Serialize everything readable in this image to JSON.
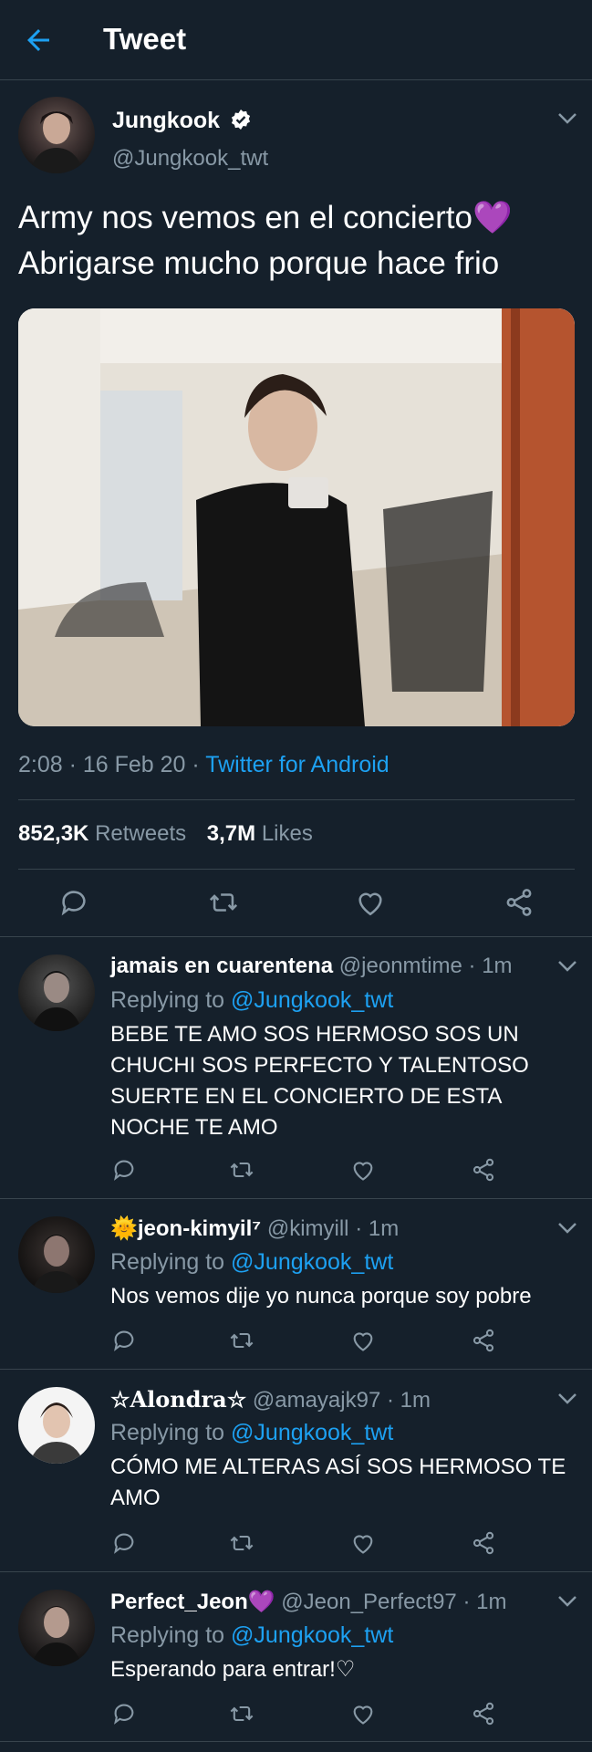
{
  "header": {
    "title": "Tweet"
  },
  "tweet": {
    "author_name": "Jungkook",
    "handle": "@Jungkook_twt",
    "text_line1": "Army nos vemos en el concierto💜",
    "text_line2": "Abrigarse mucho porque hace frio",
    "time_date": "2:08 · 16 Feb 20 · ",
    "source": "Twitter for Android",
    "retweets_count": "852,3K",
    "retweets_label": "Retweets",
    "likes_count": "3,7M",
    "likes_label": "Likes"
  },
  "replies": [
    {
      "name": "jamais en cuarentena",
      "handle": "@jeonmtime",
      "time": "· 1m",
      "replying_prefix": "Replying to ",
      "replying_handle": "@Jungkook_twt",
      "text_lines": [
        "BEBE TE AMO SOS HERMOSO SOS UN",
        "CHUCHI SOS PERFECTO Y TALENTOSO",
        "SUERTE EN EL CONCIERTO DE ESTA",
        "NOCHE TE AMO"
      ]
    },
    {
      "name": "🌞jeon-kimyil⁷",
      "handle": "@kimyill",
      "time": "· 1m",
      "replying_prefix": "Replying to ",
      "replying_handle": "@Jungkook_twt",
      "text_lines": [
        "Nos vemos dije yo nunca porque soy pobre"
      ]
    },
    {
      "name": "☆Alondra☆",
      "handle": "@amayajk97",
      "time": "· 1m",
      "replying_prefix": "Replying to ",
      "replying_handle": "@Jungkook_twt",
      "text_lines": [
        "CÓMO ME ALTERAS ASÍ SOS HERMOSO TE",
        "AMO"
      ]
    },
    {
      "name": "Perfect_Jeon💜",
      "handle": "@Jeon_Perfect97",
      "time": "· 1m",
      "replying_prefix": "Replying to ",
      "replying_handle": "@Jungkook_twt",
      "text_lines": [
        "Esperando para entrar!♡"
      ]
    }
  ],
  "colors": {
    "background": "#15202b",
    "accent": "#1da1f2",
    "muted": "#8899a6",
    "divider": "#38444d"
  },
  "icons": [
    "back-arrow-icon",
    "verified-badge-icon",
    "chevron-down-icon",
    "reply-icon",
    "retweet-icon",
    "like-icon",
    "share-icon"
  ]
}
